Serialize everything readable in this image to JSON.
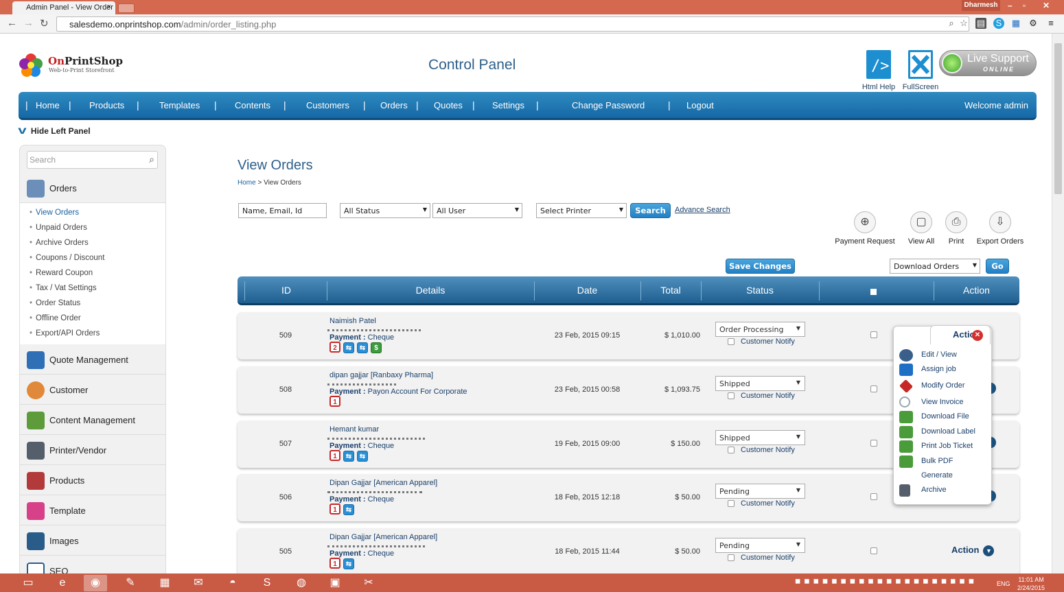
{
  "browser": {
    "tab_title": "Admin Panel - View Order",
    "tab_close": "×",
    "user_name": "Dharmesh",
    "url_host": "salesdemo.onprintshop.com",
    "url_path": "/admin/order_listing.php"
  },
  "header": {
    "logo_name_red": "On",
    "logo_name_dark": "PrintShop",
    "logo_tagline": "Web-to-Print Storefront",
    "title": "Control Panel",
    "html_help_label": "Html Help",
    "fullscreen_label": "FullScreen",
    "live_support_title": "Live Support",
    "live_support_status": "ONLINE"
  },
  "nav": {
    "items": [
      "Home",
      "Products",
      "Templates",
      "Contents",
      "Customers",
      "Orders",
      "Quotes",
      "Settings",
      "Change Password",
      "Logout"
    ],
    "welcome": "Welcome admin"
  },
  "sidebar": {
    "hide_label": "Hide Left Panel",
    "search_placeholder": "Search",
    "sections": [
      {
        "label": "Orders",
        "icon": "orders-icon",
        "color": "#6b8fb8"
      },
      {
        "label": "Quote Management",
        "icon": "quote-management-icon",
        "color": "#2f6fb6"
      },
      {
        "label": "Customer",
        "icon": "customer-icon",
        "color": "#e0893a"
      },
      {
        "label": "Content Management",
        "icon": "content-management-icon",
        "color": "#5e9b3b"
      },
      {
        "label": "Printer/Vendor",
        "icon": "printer-icon",
        "color": "#555f6b"
      },
      {
        "label": "Products",
        "icon": "products-icon",
        "color": "#b23a3a"
      },
      {
        "label": "Template",
        "icon": "template-icon",
        "color": "#d6418a"
      },
      {
        "label": "Images",
        "icon": "images-icon",
        "color": "#2a5c8a"
      },
      {
        "label": "SEO",
        "icon": "seo-icon",
        "color": "#2a5c8a"
      }
    ],
    "order_links": [
      "View Orders",
      "Unpaid Orders",
      "Archive Orders",
      "Coupons / Discount",
      "Reward Coupon",
      "Tax / Vat Settings",
      "Order Status",
      "Offline Order",
      "Export/API Orders"
    ]
  },
  "main": {
    "title": "View Orders",
    "breadcrumb_home": "Home",
    "breadcrumb_sep": ">",
    "breadcrumb_current": "View Orders",
    "filters": {
      "search_placeholder": "Name, Email, Id",
      "status": "All Status",
      "user": "All User",
      "printer": "Select Printer",
      "search_button": "Search",
      "advance_search": "Advance Search"
    },
    "tools": [
      {
        "label": "Payment Request",
        "icon": "payment-request-icon",
        "glyph": "⊕"
      },
      {
        "label": "View All",
        "icon": "view-all-icon",
        "glyph": "▢"
      },
      {
        "label": "Print",
        "icon": "print-icon",
        "glyph": "⎙"
      },
      {
        "label": "Export Orders",
        "icon": "export-orders-icon",
        "glyph": "⇩"
      }
    ],
    "save_changes": "Save Changes",
    "download_select": "Download Orders",
    "go_button": "Go",
    "columns": [
      "ID",
      "Details",
      "Date",
      "Total",
      "Status",
      "",
      "Action"
    ],
    "customer_notify": "Customer Notify",
    "payment_label": "Payment :",
    "action_label": "Action",
    "orders": [
      {
        "id": "509",
        "name": "Naimish Patel",
        "payment": "Cheque",
        "badges": [
          "2",
          "blue",
          "blue",
          "green"
        ],
        "date": "23 Feb, 2015 09:15",
        "total": "$ 1,010.00",
        "status": "Order Processing"
      },
      {
        "id": "508",
        "name": "dipan gajjar [Ranbaxy Pharma]",
        "payment": "Payon Account For Corporate",
        "badges": [
          "1"
        ],
        "date": "23 Feb, 2015 00:58",
        "total": "$ 1,093.75",
        "status": "Shipped"
      },
      {
        "id": "507",
        "name": "Hemant kumar",
        "payment": "Cheque",
        "badges": [
          "1",
          "blue",
          "blue"
        ],
        "date": "19 Feb, 2015 09:00",
        "total": "$ 150.00",
        "status": "Shipped"
      },
      {
        "id": "506",
        "name": "Dipan Gajjar [American Apparel]",
        "payment": "Cheque",
        "badges": [
          "1",
          "blue"
        ],
        "date": "18 Feb, 2015 12:18",
        "total": "$ 50.00",
        "status": "Pending"
      },
      {
        "id": "505",
        "name": "Dipan Gajjar [American Apparel]",
        "payment": "Cheque",
        "badges": [
          "1",
          "blue"
        ],
        "date": "18 Feb, 2015 11:44",
        "total": "$ 50.00",
        "status": "Pending"
      }
    ],
    "action_menu": {
      "title": "Action",
      "items": [
        {
          "label": "Edit / View",
          "icon": "edit-view-icon",
          "color": "#3a5f8a"
        },
        {
          "label": "Assign job",
          "icon": "assign-job-icon",
          "color": "#1f6fc4"
        },
        {
          "label": "Modify Order",
          "icon": "modify-order-icon",
          "color": "#c62828"
        },
        {
          "label": "View Invoice",
          "icon": "view-invoice-icon",
          "color": "#9aa6b2"
        },
        {
          "label": "Download File",
          "icon": "download-file-icon",
          "color": "#4a9b3a"
        },
        {
          "label": "Download Label",
          "icon": "download-label-icon",
          "color": "#4a9b3a"
        },
        {
          "label": "Print Job Ticket",
          "icon": "print-job-ticket-icon",
          "color": "#4a9b3a"
        },
        {
          "label": "Bulk PDF",
          "icon": "bulk-pdf-icon",
          "color": "#4a9b3a"
        },
        {
          "label": "Generate",
          "icon": "",
          "color": ""
        },
        {
          "label": "Archive",
          "icon": "archive-icon",
          "color": "#555f6b"
        }
      ]
    }
  },
  "taskbar": {
    "lang": "ENG",
    "time": "11:01 AM",
    "date": "2/24/2015"
  }
}
